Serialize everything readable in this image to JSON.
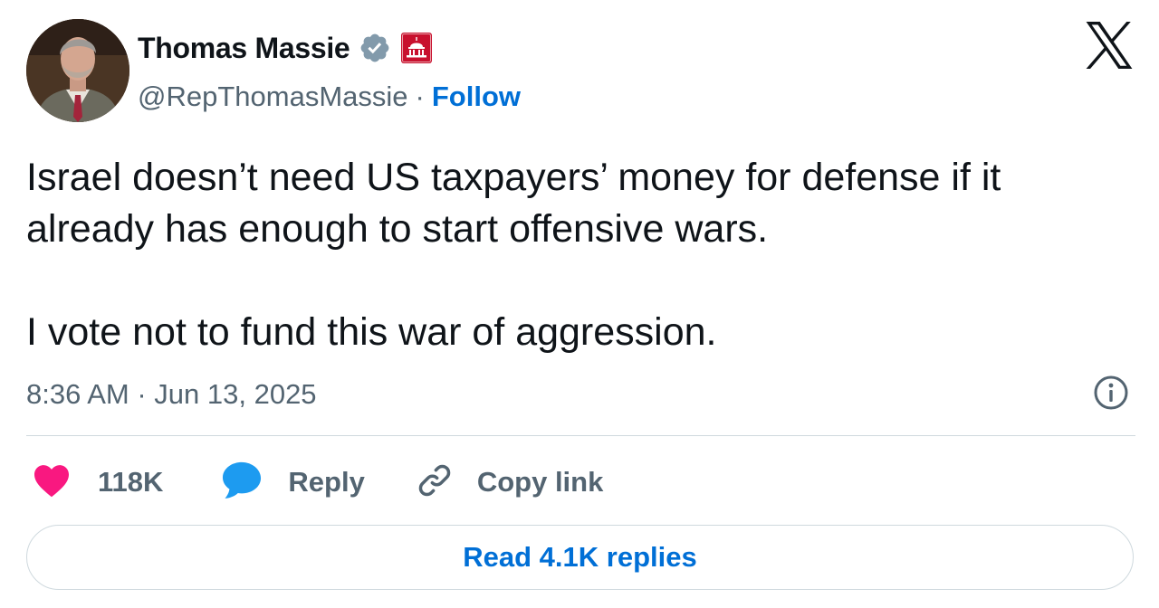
{
  "author": {
    "display_name": "Thomas Massie",
    "handle": "@RepThomasMassie",
    "separator": "·",
    "follow_label": "Follow",
    "avatar_icon": "person-avatar",
    "verified_icon": "verified-badge-icon",
    "affiliation_icon": "us-capitol-badge-icon"
  },
  "tweet": {
    "paragraphs": [
      "Israel doesn’t need US taxpayers’ money for defense if it already has enough to start offensive wars.",
      "I vote not to fund this war of aggression."
    ],
    "timestamp": "8:36 AM · Jun 13, 2025"
  },
  "actions": {
    "like_count": "118K",
    "reply_label": "Reply",
    "copy_link_label": "Copy link"
  },
  "read_replies_label": "Read 4.1K replies",
  "colors": {
    "like": "#f91880",
    "reply": "#1d9bf0",
    "link": "#006fd6",
    "muted": "#536471",
    "verified": "#829aab",
    "gov_badge": "#c8102e"
  }
}
